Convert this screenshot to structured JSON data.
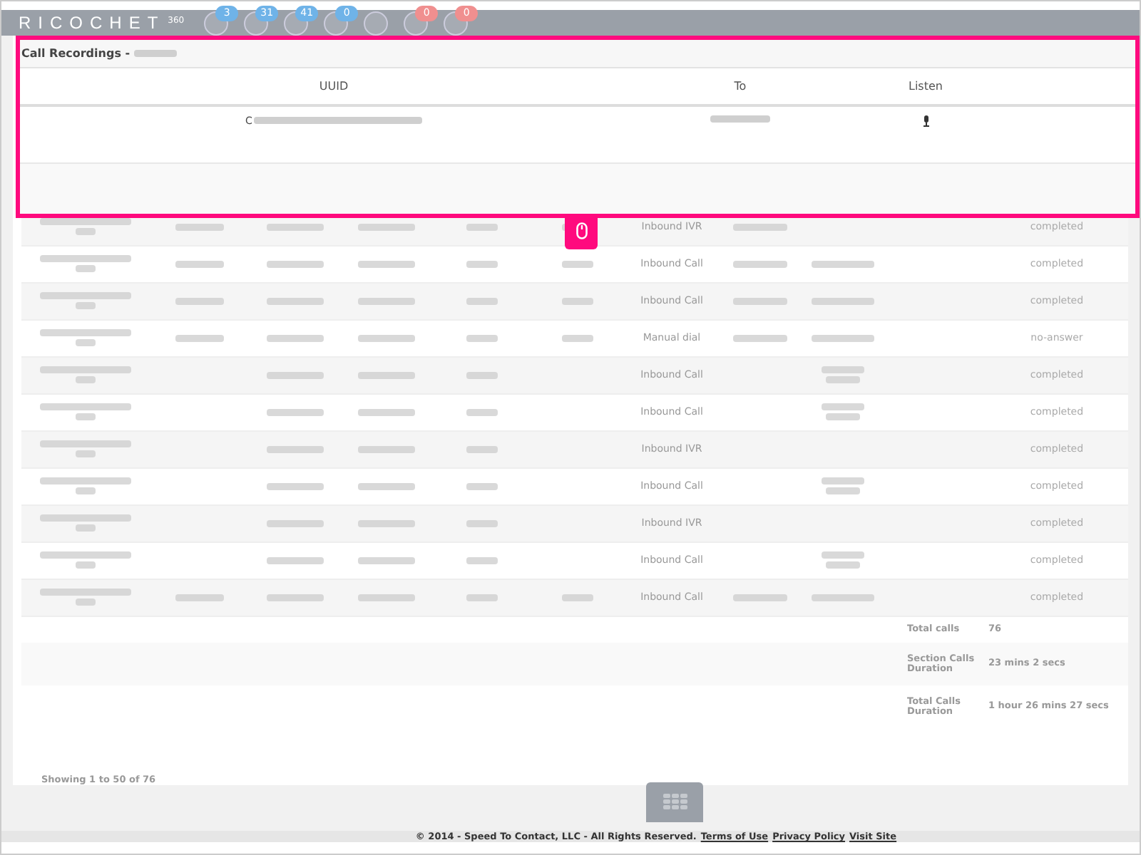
{
  "header": {
    "logo": "RICOCHET",
    "logo_suffix": "360",
    "icons": [
      {
        "kind": "badged",
        "badge": "3",
        "color": "#6fb3e8"
      },
      {
        "kind": "badged",
        "badge": "31",
        "color": "#6fb3e8"
      },
      {
        "kind": "badged",
        "badge": "41",
        "color": "#6fb3e8"
      },
      {
        "kind": "badged",
        "badge": "0",
        "color": "#6fb3e8"
      },
      {
        "kind": "plain"
      },
      {
        "kind": "badged",
        "badge": "0",
        "color": "#f08f8f"
      },
      {
        "kind": "badged",
        "badge": "0",
        "color": "#f08f8f"
      }
    ]
  },
  "modal": {
    "title": "Call Recordings -",
    "columns": [
      "UUID",
      "To",
      "Listen"
    ],
    "uuid_prefix": "C"
  },
  "rows": [
    {
      "kind": "agent",
      "has_contact": false,
      "type": "Inbound IVR",
      "status": "completed"
    },
    {
      "kind": "agent",
      "has_contact": true,
      "type": "Inbound Call",
      "status": "completed"
    },
    {
      "kind": "agent",
      "has_contact": true,
      "type": "Inbound Call",
      "status": "completed"
    },
    {
      "kind": "agent",
      "has_contact": true,
      "type": "Manual dial",
      "status": "no-answer"
    },
    {
      "kind": "queue",
      "has_contact": true,
      "type": "Inbound Call",
      "status": "completed"
    },
    {
      "kind": "queue",
      "has_contact": true,
      "type": "Inbound Call",
      "status": "completed"
    },
    {
      "kind": "queue",
      "has_contact": false,
      "type": "Inbound IVR",
      "status": "completed"
    },
    {
      "kind": "queue",
      "has_contact": true,
      "type": "Inbound Call",
      "status": "completed"
    },
    {
      "kind": "queue",
      "has_contact": false,
      "type": "Inbound IVR",
      "status": "completed"
    },
    {
      "kind": "queue",
      "has_contact": true,
      "type": "Inbound Call",
      "status": "completed"
    },
    {
      "kind": "agent",
      "has_contact": true,
      "type": "Inbound Call",
      "status": "completed"
    }
  ],
  "summary": [
    {
      "label": "Total calls",
      "value": "76"
    },
    {
      "label": "Section Calls Duration",
      "value": "23 mins 2 secs"
    },
    {
      "label": "Total Calls Duration",
      "value": "1 hour 26 mins 27 secs"
    }
  ],
  "showing": "Showing 1 to 50 of 76",
  "footer": {
    "text": "© 2014 - Speed To Contact, LLC - All Rights Reserved.",
    "links": [
      "Terms of Use",
      "Privacy Policy",
      "Visit Site"
    ]
  }
}
